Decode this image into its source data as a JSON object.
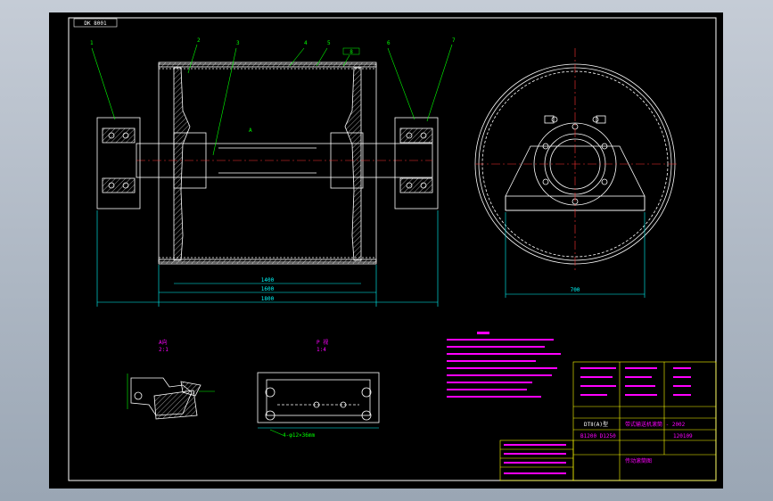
{
  "colors": {
    "background": "#000000",
    "frame": "#ffffff",
    "outline": "#ffffff",
    "leader": "#00ff00",
    "dimension": "#00ffff",
    "notes": "#ff00ff",
    "hatch": "#ffffff",
    "center_line": "#ff3333",
    "title_block": "#ffff00"
  },
  "drawing": {
    "sheet_tag": "DK 8001",
    "callouts": [
      "1",
      "2",
      "3",
      "4",
      "5",
      "6",
      "7",
      "8"
    ],
    "section_mark": "A",
    "detail_left": {
      "title": "A向",
      "scale": "2:1"
    },
    "detail_right": {
      "title": "P 视",
      "scale": "1:4"
    },
    "bolt_note": "4-φ12×36mm",
    "dims_bottom": [
      "1400",
      "1600",
      "1800"
    ],
    "dim_side": "700",
    "title_block": {
      "series": "DTⅡ(A)型",
      "product": "带式输送机滚筒 - 2002",
      "sizes": "B1200  D1250",
      "drawing_no": "120109",
      "part_name": "传动滚筒图"
    }
  }
}
